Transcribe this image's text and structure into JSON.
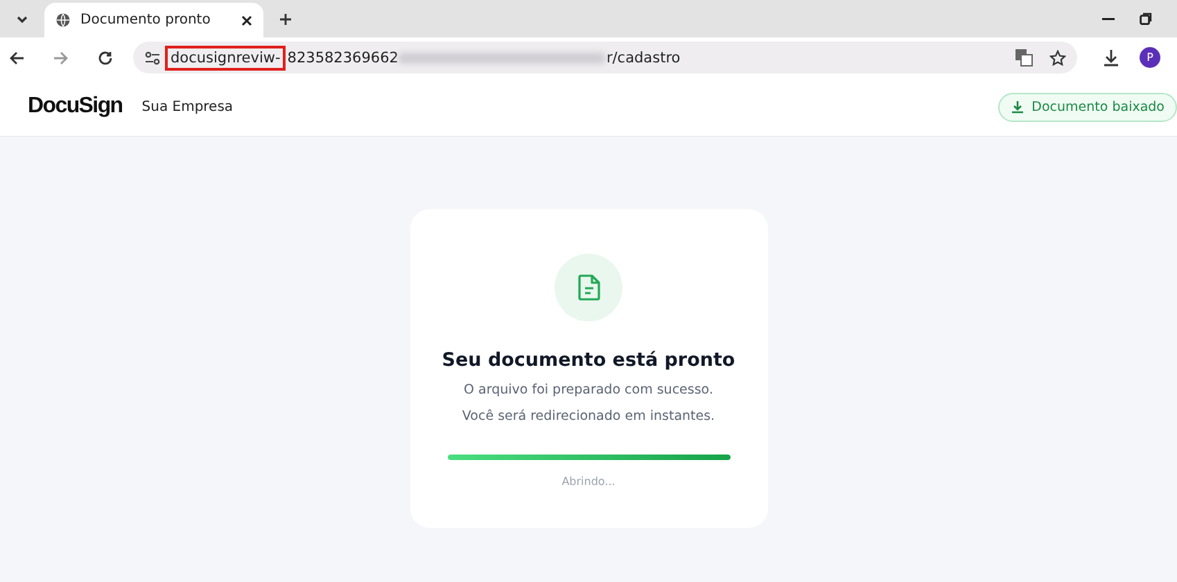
{
  "browser": {
    "tab": {
      "title": "Documento pronto",
      "selected": true
    },
    "url": {
      "highlighted": "docusignreviw-",
      "rest": "823582369662",
      "path": "r/cadastro"
    },
    "profile_initial": "P"
  },
  "header": {
    "logo": "DocuSign",
    "company": "Sua Empresa",
    "status_button": "Documento baixado"
  },
  "card": {
    "title": "Seu documento está pronto",
    "message": [
      "O arquivo foi preparado com sucesso.",
      "Você será redirecionado em instantes."
    ],
    "progress": {
      "level": 1
    },
    "status": "Abrindo..."
  }
}
